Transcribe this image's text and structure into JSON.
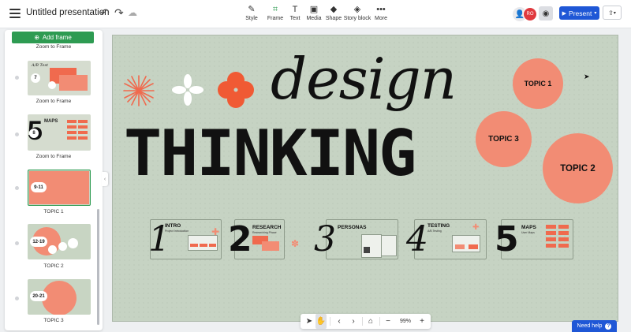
{
  "header": {
    "doc_title": "Untitled presentation",
    "tools": [
      {
        "label": "Style",
        "icon": "✎"
      },
      {
        "label": "Frame",
        "icon": "⌗"
      },
      {
        "label": "Text",
        "icon": "T"
      },
      {
        "label": "Media",
        "icon": "▣"
      },
      {
        "label": "Shape",
        "icon": "◆"
      },
      {
        "label": "Story block",
        "icon": "◈"
      },
      {
        "label": "More",
        "icon": "•••"
      }
    ],
    "present_label": "Present",
    "avatar_initials": "RO"
  },
  "sidebar": {
    "add_frame_label": "Add frame",
    "frames": [
      {
        "label": "Zoom to Frame"
      },
      {
        "label": "Zoom to Frame",
        "badge": "7"
      },
      {
        "label": "Zoom to Frame",
        "badge": "8"
      },
      {
        "label": "TOPIC 1",
        "badge": "9-11"
      },
      {
        "label": "TOPIC 2",
        "badge": "12-19"
      },
      {
        "label": "TOPIC 3",
        "badge": "20-21"
      }
    ]
  },
  "canvas": {
    "design_word": "design",
    "thinking_word": "THINKING",
    "topics": [
      "TOPIC 1",
      "TOPIC 2",
      "TOPIC 3"
    ],
    "sections": [
      {
        "num": "1",
        "title": "INTRO"
      },
      {
        "num": "2",
        "title": "RESEARCH"
      },
      {
        "num": "3",
        "title": "PERSONAS"
      },
      {
        "num": "4",
        "title": "TESTING"
      },
      {
        "num": "5",
        "title": "MAPS"
      }
    ],
    "accent_color": "#f28c74",
    "orange_color": "#f05a34",
    "background_color": "#c6d3c3"
  },
  "bottom_toolbar": {
    "zoom": "99%"
  },
  "help": {
    "label": "Need help"
  }
}
